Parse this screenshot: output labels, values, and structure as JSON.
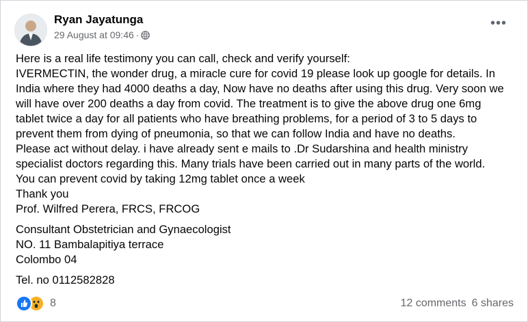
{
  "post": {
    "author": "Ryan Jayatunga",
    "timestamp": "29 August at 09:46",
    "separator": "·",
    "audience_icon": "globe-icon",
    "more_icon": "more-options-icon",
    "more_label": "•••",
    "paragraphs": [
      "Here is a real life testimony you can call, check and verify yourself:\nIVERMECTIN,  the wonder drug, a miracle cure for covid 19 please look up google for details. In\nIndia  where they had 4000 deaths a day, Now have no deaths after using this drug. Very soon we\nwill have over 200 deaths a day from covid. The  treatment is to give the above drug one 6mg\ntablet twice a day for all patients who have breathing problems, for a period of 3 to 5  days to\nprevent them from dying of pneumonia, so that we can follow India and have no deaths.\nPlease act without delay. i have already sent e mails to .Dr Sudarshina  and health ministry\nspecialist doctors regarding this. Many trials have been carried out in many parts of the world.\nYou can prevent covid by taking 12mg tablet once a week\nThank you\nProf. Wilfred Perera, FRCS, FRCOG",
      "Consultant Obstetrician and Gynaecologist\nNO. 11 Bambalapitiya terrace\nColombo 04",
      "Tel. no 0112582828"
    ]
  },
  "footer": {
    "reaction_icons": [
      "like-reaction-icon",
      "wow-reaction-icon"
    ],
    "reaction_count": "8",
    "comments": "12 comments",
    "shares": "6 shares"
  },
  "colors": {
    "like": "#1877f2",
    "wow": "#f7b125",
    "meta_text": "#65676b"
  }
}
